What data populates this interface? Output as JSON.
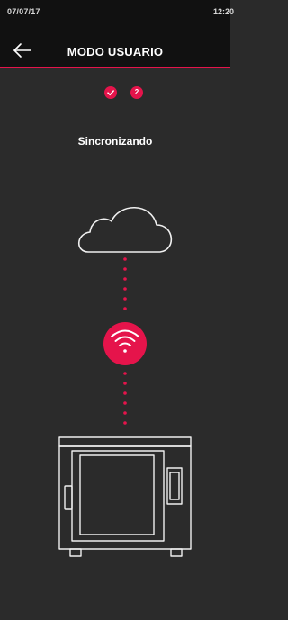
{
  "status_bar": {
    "date": "07/07/17",
    "time": "12:20"
  },
  "app_bar": {
    "title": "MODO USUARIO",
    "back_icon": "arrow-left-icon"
  },
  "steps": [
    {
      "label": "",
      "icon": "check-icon",
      "state": "done"
    },
    {
      "label": "2",
      "state": "current"
    }
  ],
  "main": {
    "status_text": "Sincronizando"
  },
  "illustration": {
    "icons": [
      "cloud-icon",
      "wifi-icon",
      "oven-icon"
    ]
  },
  "colors": {
    "accent": "#e5144b",
    "background": "#2b2b2b",
    "bar_background": "#111111",
    "line_art": "#f0f0f0"
  }
}
